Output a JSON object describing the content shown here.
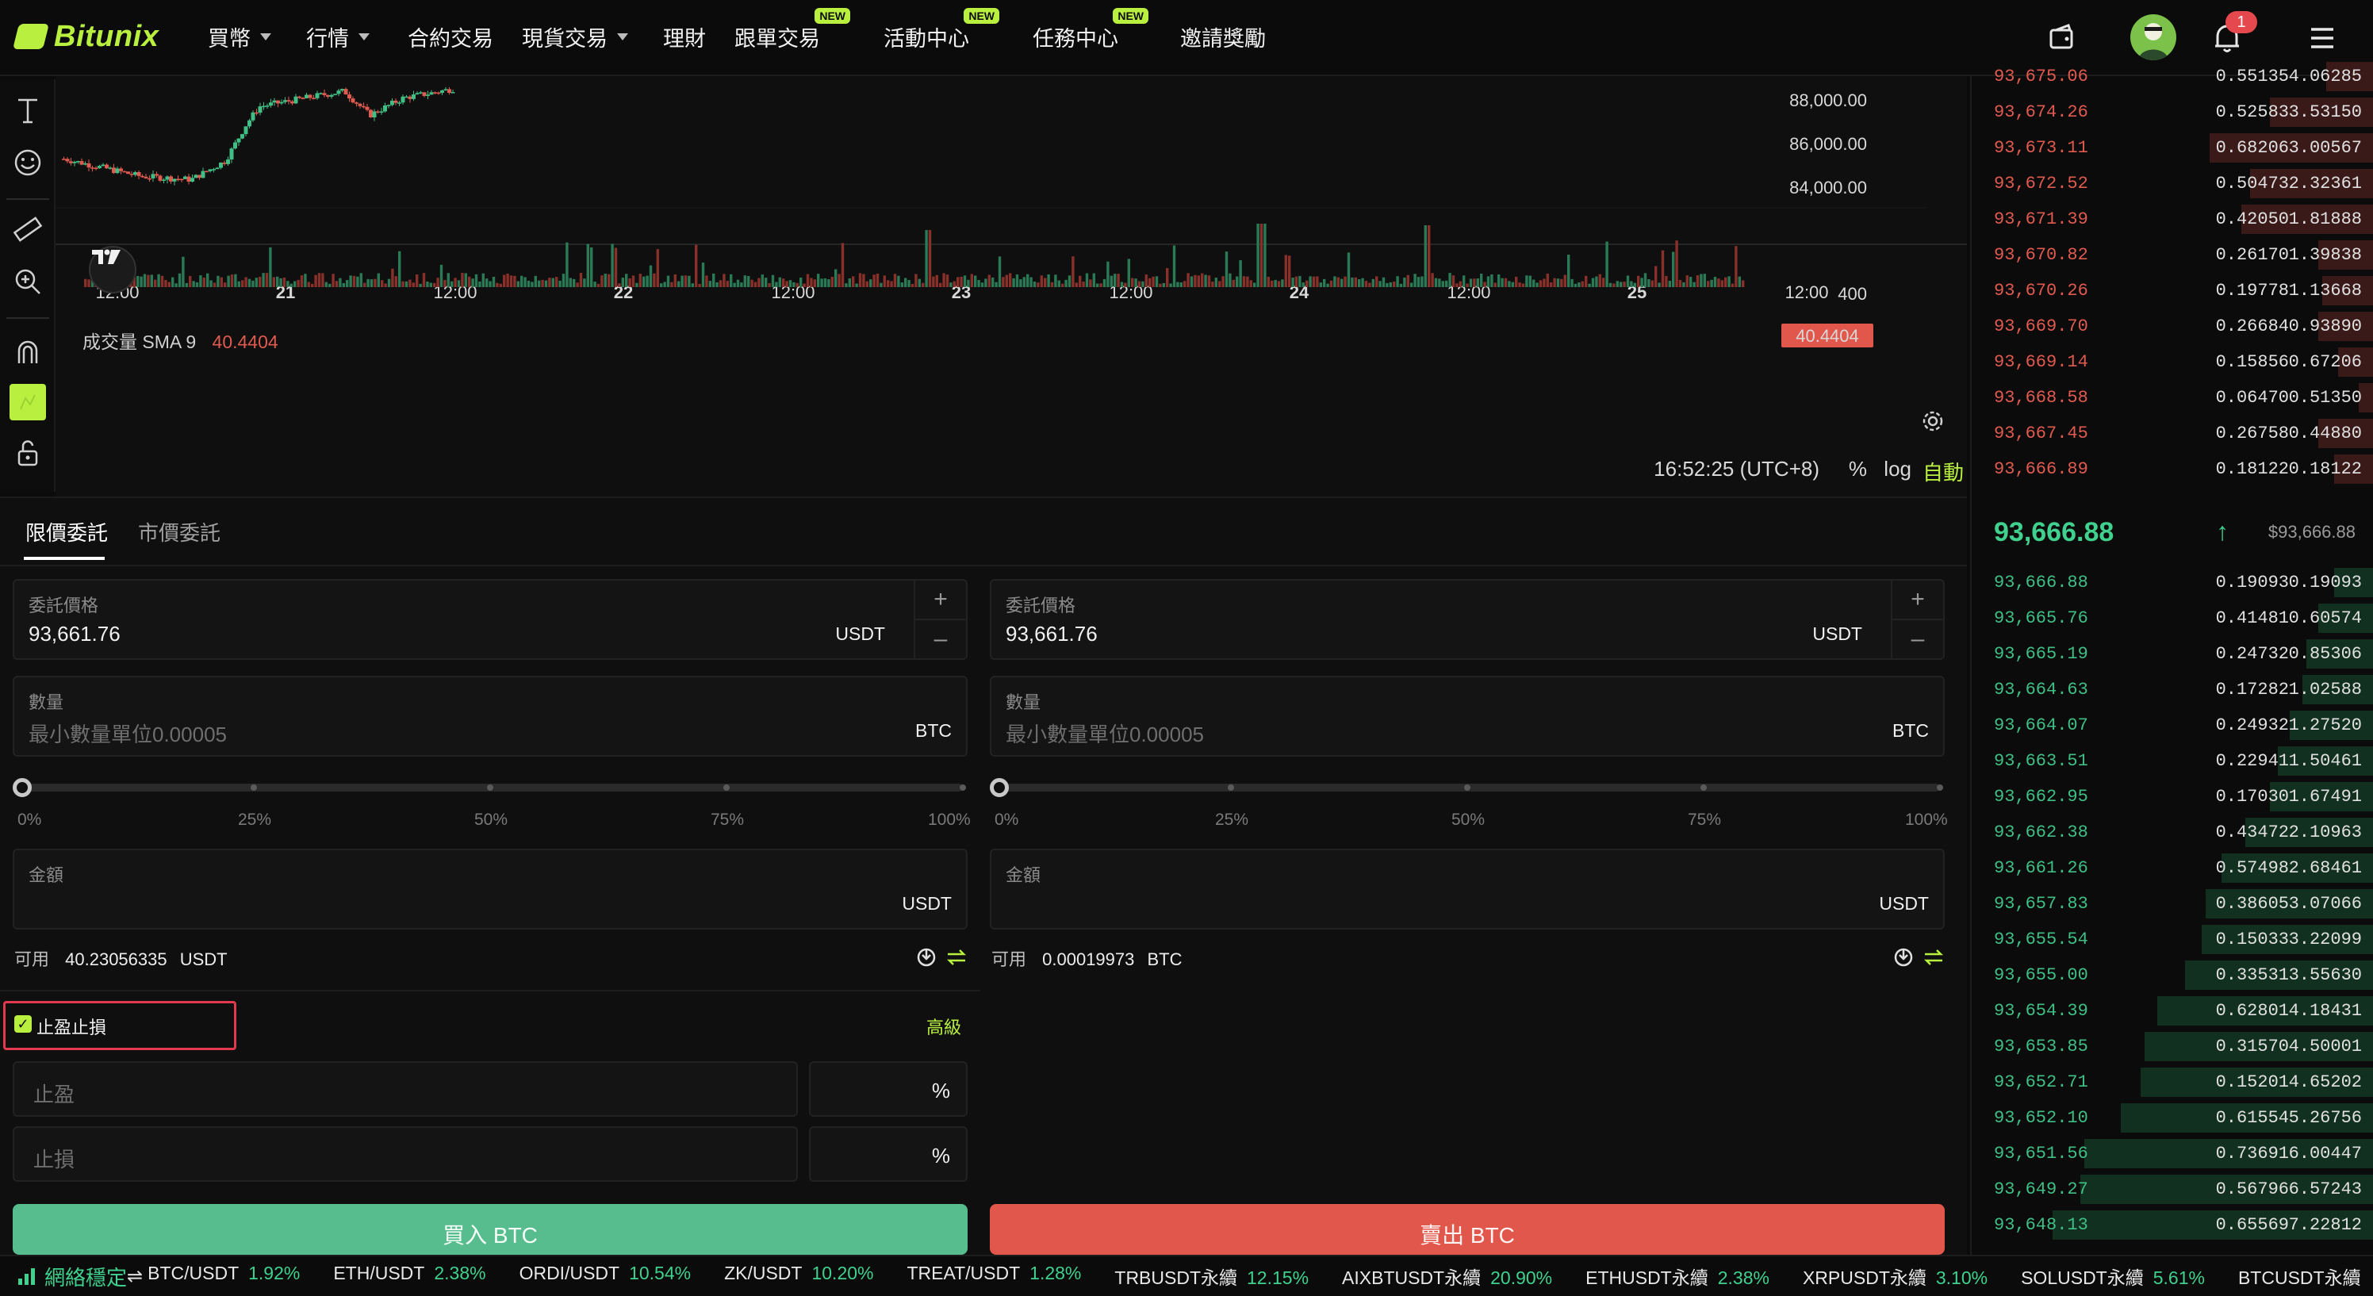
{
  "brand": {
    "name": "Bitunix",
    "accent": "#b9f040",
    "up": "#3fbf85",
    "down": "#e05a4f"
  },
  "nav": {
    "items": [
      {
        "label": "買幣",
        "dropdown": true,
        "new": false
      },
      {
        "label": "行情",
        "dropdown": true,
        "new": false
      },
      {
        "label": "合約交易",
        "dropdown": false,
        "new": false
      },
      {
        "label": "現貨交易",
        "dropdown": true,
        "new": false
      },
      {
        "label": "理財",
        "dropdown": false,
        "new": false
      },
      {
        "label": "跟單交易",
        "dropdown": false,
        "new": true
      },
      {
        "label": "活動中心",
        "dropdown": false,
        "new": true
      },
      {
        "label": "任務中心",
        "dropdown": false,
        "new": true
      },
      {
        "label": "邀請獎勵",
        "dropdown": false,
        "new": false
      }
    ],
    "new_badge": "NEW",
    "notification_count": "1"
  },
  "chart": {
    "price_axis": [
      "88,000.00",
      "86,000.00",
      "84,000.00"
    ],
    "volume_axis": "400",
    "volume_label": "成交量 SMA 9",
    "volume_value": "40.4404",
    "volume_current_tag": "40.4404",
    "time_axis": [
      "12:00",
      "21",
      "12:00",
      "22",
      "12:00",
      "23",
      "12:00",
      "24",
      "12:00",
      "25",
      "12:00"
    ],
    "clock": "16:52:25 (UTC+8)",
    "opt_percent": "%",
    "opt_log": "log",
    "opt_auto": "自動"
  },
  "chart_data": {
    "type": "candlestick",
    "price_axis_ticks": [
      88000,
      86000,
      84000
    ],
    "volume_axis_ticks": [
      400
    ],
    "x_ticks": [
      "12:00",
      "21",
      "12:00",
      "22",
      "12:00",
      "23",
      "12:00",
      "24",
      "12:00",
      "25",
      "12:00"
    ],
    "current_volume": 40.4404
  },
  "order": {
    "tabs": [
      "限價委託",
      "市價委託"
    ],
    "buy": {
      "price_label": "委託價格",
      "price_value": "93,661.76",
      "price_unit": "USDT",
      "qty_label": "數量",
      "qty_placeholder": "最小數量單位0.00005",
      "qty_unit": "BTC",
      "amount_label": "金額",
      "amount_unit": "USDT",
      "avail_label": "可用",
      "avail_value": "40.23056335",
      "avail_unit": "USDT",
      "button": "買入 BTC"
    },
    "sell": {
      "price_label": "委託價格",
      "price_value": "93,661.76",
      "price_unit": "USDT",
      "qty_label": "數量",
      "qty_placeholder": "最小數量單位0.00005",
      "qty_unit": "BTC",
      "amount_label": "金額",
      "amount_unit": "USDT",
      "avail_label": "可用",
      "avail_value": "0.00019973",
      "avail_unit": "BTC",
      "button": "賣出 BTC"
    },
    "slider_marks": [
      "0%",
      "25%",
      "50%",
      "75%",
      "100%"
    ],
    "tpsl": {
      "label": "止盈止損",
      "checked": true,
      "advanced": "高級",
      "tp_placeholder": "止盈",
      "sl_placeholder": "止損",
      "unit": "%"
    },
    "stepper_plus": "+",
    "stepper_minus": "–"
  },
  "orderbook": {
    "asks": [
      [
        "93,675.06",
        "0.55135",
        "4.06285",
        0.12
      ],
      [
        "93,674.26",
        "0.52583",
        "3.53150",
        0.26
      ],
      [
        "93,673.11",
        "0.68206",
        "3.00567",
        0.41
      ],
      [
        "93,672.52",
        "0.50473",
        "2.32361",
        0.31
      ],
      [
        "93,671.39",
        "0.42050",
        "1.81888",
        0.33
      ],
      [
        "93,670.82",
        "0.26170",
        "1.39838",
        0.14
      ],
      [
        "93,670.26",
        "0.19778",
        "1.13668",
        0.13
      ],
      [
        "93,669.70",
        "0.26684",
        "0.93890",
        0.14
      ],
      [
        "93,669.14",
        "0.15856",
        "0.67206",
        0.09
      ],
      [
        "93,668.58",
        "0.06470",
        "0.51350",
        0.04
      ],
      [
        "93,667.45",
        "0.26758",
        "0.44880",
        0.14
      ],
      [
        "93,666.89",
        "0.18122",
        "0.18122",
        0.1
      ]
    ],
    "mid_price": "93,666.88",
    "mid_usd": "$93,666.88",
    "bids": [
      [
        "93,666.88",
        "0.19093",
        "0.19093",
        0.1
      ],
      [
        "93,665.76",
        "0.41481",
        "0.60574",
        0.14
      ],
      [
        "93,665.19",
        "0.24732",
        "0.85306",
        0.17
      ],
      [
        "93,664.63",
        "0.17282",
        "1.02588",
        0.18
      ],
      [
        "93,664.07",
        "0.24932",
        "1.27520",
        0.21
      ],
      [
        "93,663.51",
        "0.22941",
        "1.50461",
        0.24
      ],
      [
        "93,662.95",
        "0.17030",
        "1.67491",
        0.26
      ],
      [
        "93,662.38",
        "0.43472",
        "2.10963",
        0.32
      ],
      [
        "93,661.26",
        "0.57498",
        "2.68461",
        0.38
      ],
      [
        "93,657.83",
        "0.38605",
        "3.07066",
        0.42
      ],
      [
        "93,655.54",
        "0.15033",
        "3.22099",
        0.43
      ],
      [
        "93,655.00",
        "0.33531",
        "3.55630",
        0.47
      ],
      [
        "93,654.39",
        "0.62801",
        "4.18431",
        0.54
      ],
      [
        "93,653.85",
        "0.31570",
        "4.50001",
        0.57
      ],
      [
        "93,652.71",
        "0.15201",
        "4.65202",
        0.58
      ],
      [
        "93,652.10",
        "0.61554",
        "5.26756",
        0.63
      ],
      [
        "93,651.56",
        "0.73691",
        "6.00447",
        0.72
      ],
      [
        "93,649.27",
        "0.56796",
        "6.57243",
        0.73
      ],
      [
        "93,648.13",
        "0.65569",
        "7.22812",
        0.8
      ]
    ]
  },
  "ticker": {
    "status": "網絡穩定",
    "items": [
      {
        "pair": "BTC/USDT",
        "change": "1.92%"
      },
      {
        "pair": "ETH/USDT",
        "change": "2.38%"
      },
      {
        "pair": "ORDI/USDT",
        "change": "10.54%"
      },
      {
        "pair": "ZK/USDT",
        "change": "10.20%"
      },
      {
        "pair": "TREAT/USDT",
        "change": "1.28%"
      },
      {
        "pair": "TRBUSDT永續",
        "change": "12.15%"
      },
      {
        "pair": "AIXBTUSDT永續",
        "change": "20.90%"
      },
      {
        "pair": "ETHUSDT永續",
        "change": "2.38%"
      },
      {
        "pair": "XRPUSDT永續",
        "change": "3.10%"
      },
      {
        "pair": "SOLUSDT永續",
        "change": "5.61%"
      },
      {
        "pair": "BTCUSDT永續",
        "change": ""
      }
    ]
  }
}
